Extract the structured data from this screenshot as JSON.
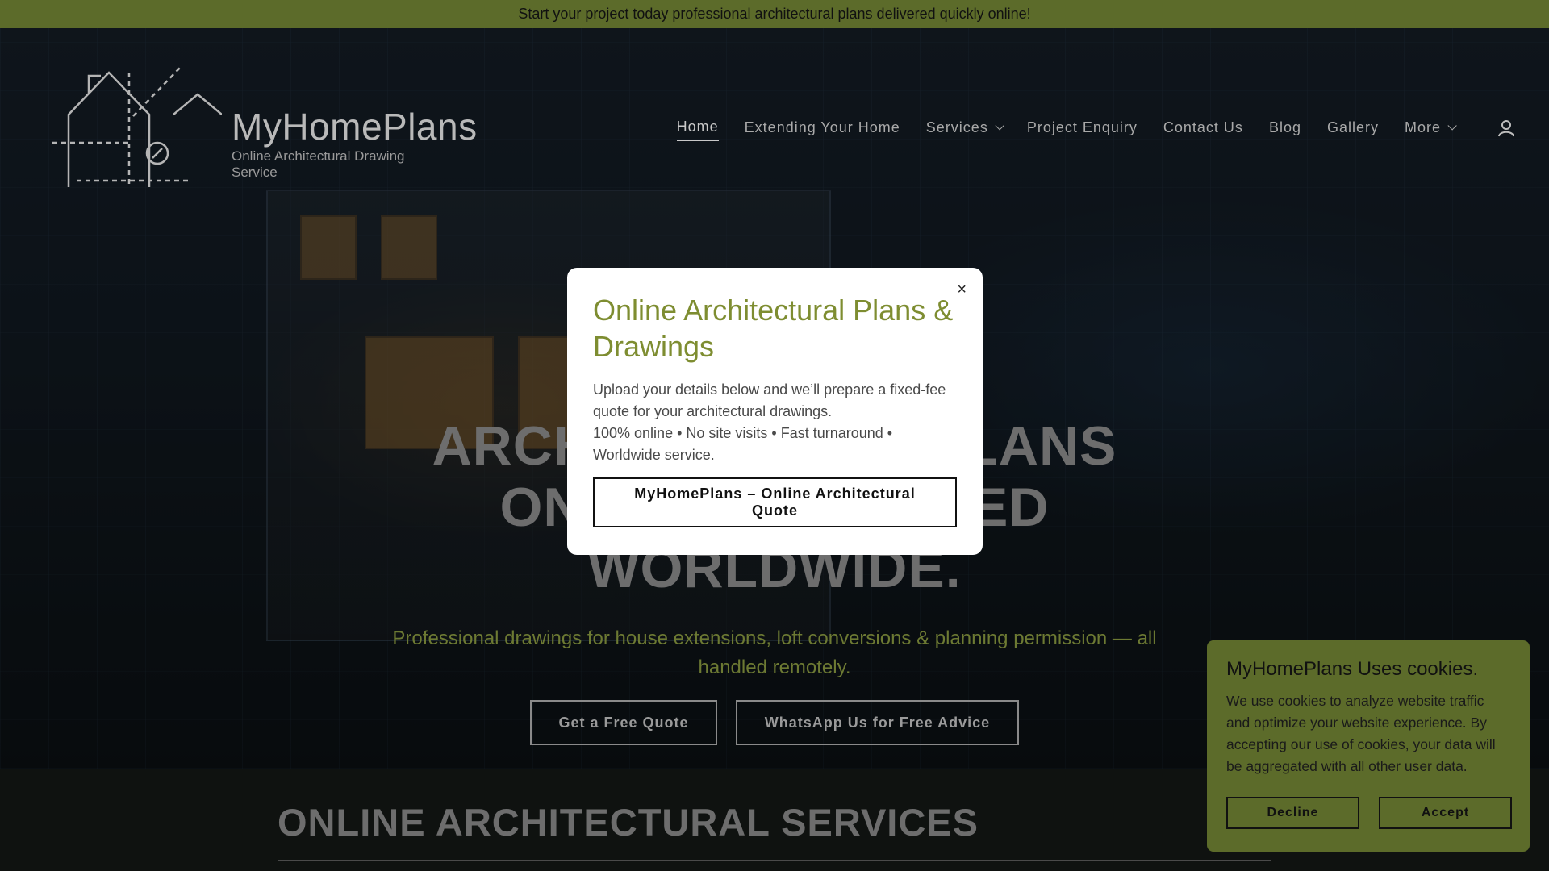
{
  "announcement": "Start your project today professional architectural plans delivered quickly online!",
  "logo": {
    "name": "MyHomePlans",
    "tagline": "Online Architectural Drawing Service"
  },
  "nav": {
    "items": [
      {
        "label": "Home",
        "active": true
      },
      {
        "label": "Extending Your Home"
      },
      {
        "label": "Services",
        "dropdown": true
      },
      {
        "label": "Project Enquiry"
      },
      {
        "label": "Contact Us"
      },
      {
        "label": "Blog"
      },
      {
        "label": "Gallery"
      },
      {
        "label": "More",
        "dropdown": true
      }
    ],
    "account_icon": "user-icon"
  },
  "hero": {
    "title_line1": "ARCHITECTURAL PLANS",
    "title_line2": "ONLINE DELIVERED",
    "title_line3": "WORLDWIDE.",
    "subtitle": "Professional drawings for house extensions, loft conversions & planning permission — all handled remotely.",
    "cta_primary": "Get a Free Quote",
    "cta_secondary": "WhatsApp Us for Free Advice"
  },
  "services": {
    "title": "ONLINE ARCHITECTURAL SERVICES"
  },
  "modal": {
    "close": "×",
    "title": "Online Architectural Plans & Drawings",
    "body_line1": "Upload your details below and we’ll prepare a fixed-fee quote for your architectural drawings.",
    "body_line2": "100% online • No site visits • Fast turnaround • Worldwide service.",
    "button": "MyHomePlans – Online Architectural Quote"
  },
  "cookie": {
    "title": "MyHomePlans Uses cookies.",
    "text": "We use cookies to analyze website traffic and optimize your website experience. By accepting our use of cookies, your data will be aggregated with all other user data.",
    "decline": "Decline",
    "accept": "Accept"
  },
  "colors": {
    "accent": "#7e8d31",
    "banner": "#5c6b2a"
  }
}
